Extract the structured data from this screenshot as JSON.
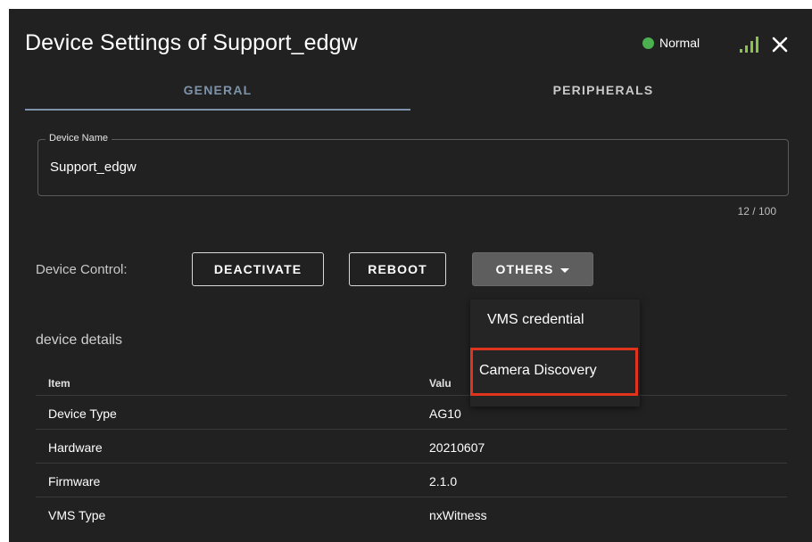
{
  "dialog": {
    "title": "Device Settings of Support_edgw",
    "status_text": "Normal",
    "status_color": "#4caf50",
    "signal_icon": "signal-bars-icon",
    "close_icon": "close-icon"
  },
  "tabs": [
    {
      "label": "GENERAL",
      "active": true
    },
    {
      "label": "PERIPHERALS",
      "active": false
    }
  ],
  "device_name": {
    "label": "Device Name",
    "value": "Support_edgw",
    "counter": "12 / 100"
  },
  "device_control": {
    "label": "Device Control:",
    "deactivate_label": "DEACTIVATE",
    "reboot_label": "REBOOT",
    "others_label": "OTHERS"
  },
  "others_menu": {
    "items": [
      {
        "label": "VMS credential"
      },
      {
        "label": "Camera Discovery"
      }
    ]
  },
  "details": {
    "title": "device details",
    "columns": [
      "Item",
      "Valu"
    ],
    "rows": [
      {
        "item": "Device Type",
        "value": "AG10"
      },
      {
        "item": "Hardware",
        "value": "20210607"
      },
      {
        "item": "Firmware",
        "value": "2.1.0"
      },
      {
        "item": "VMS Type",
        "value": "nxWitness"
      }
    ]
  },
  "colors": {
    "background": "#212121",
    "accent": "#7d93aa",
    "highlight_border": "#e0341d",
    "signal": "#8bc34a"
  }
}
